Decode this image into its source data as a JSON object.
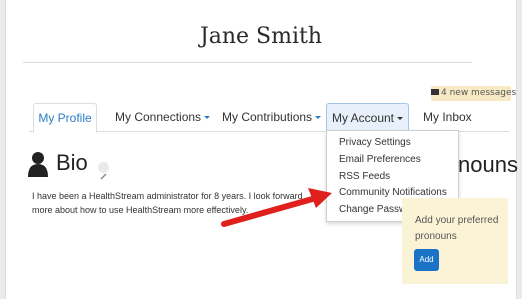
{
  "profile": {
    "name": "Jane Smith"
  },
  "messages": {
    "label": "4 new messages"
  },
  "tabs": [
    {
      "label": "My Profile"
    },
    {
      "label": "My Connections"
    },
    {
      "label": "My Contributions"
    },
    {
      "label": "My Account"
    },
    {
      "label": "My Inbox"
    }
  ],
  "account_menu": {
    "items": [
      {
        "label": "Privacy Settings"
      },
      {
        "label": "Email Preferences"
      },
      {
        "label": "RSS Feeds"
      },
      {
        "label": "Community Notifications"
      },
      {
        "label": "Change Password"
      }
    ]
  },
  "bio": {
    "heading": "Bio",
    "line1": "I have been a HealthStream administrator for 8 years. I look forward",
    "line2": "more about how to use HealthStream more effectively."
  },
  "pronouns": {
    "heading": "nouns",
    "prompt": "Add your preferred pronouns",
    "add_label": "Add"
  },
  "colors": {
    "accent": "#2b7cc7",
    "annotation_arrow": "#e0201c",
    "notice_bg": "#fbf3d6"
  }
}
